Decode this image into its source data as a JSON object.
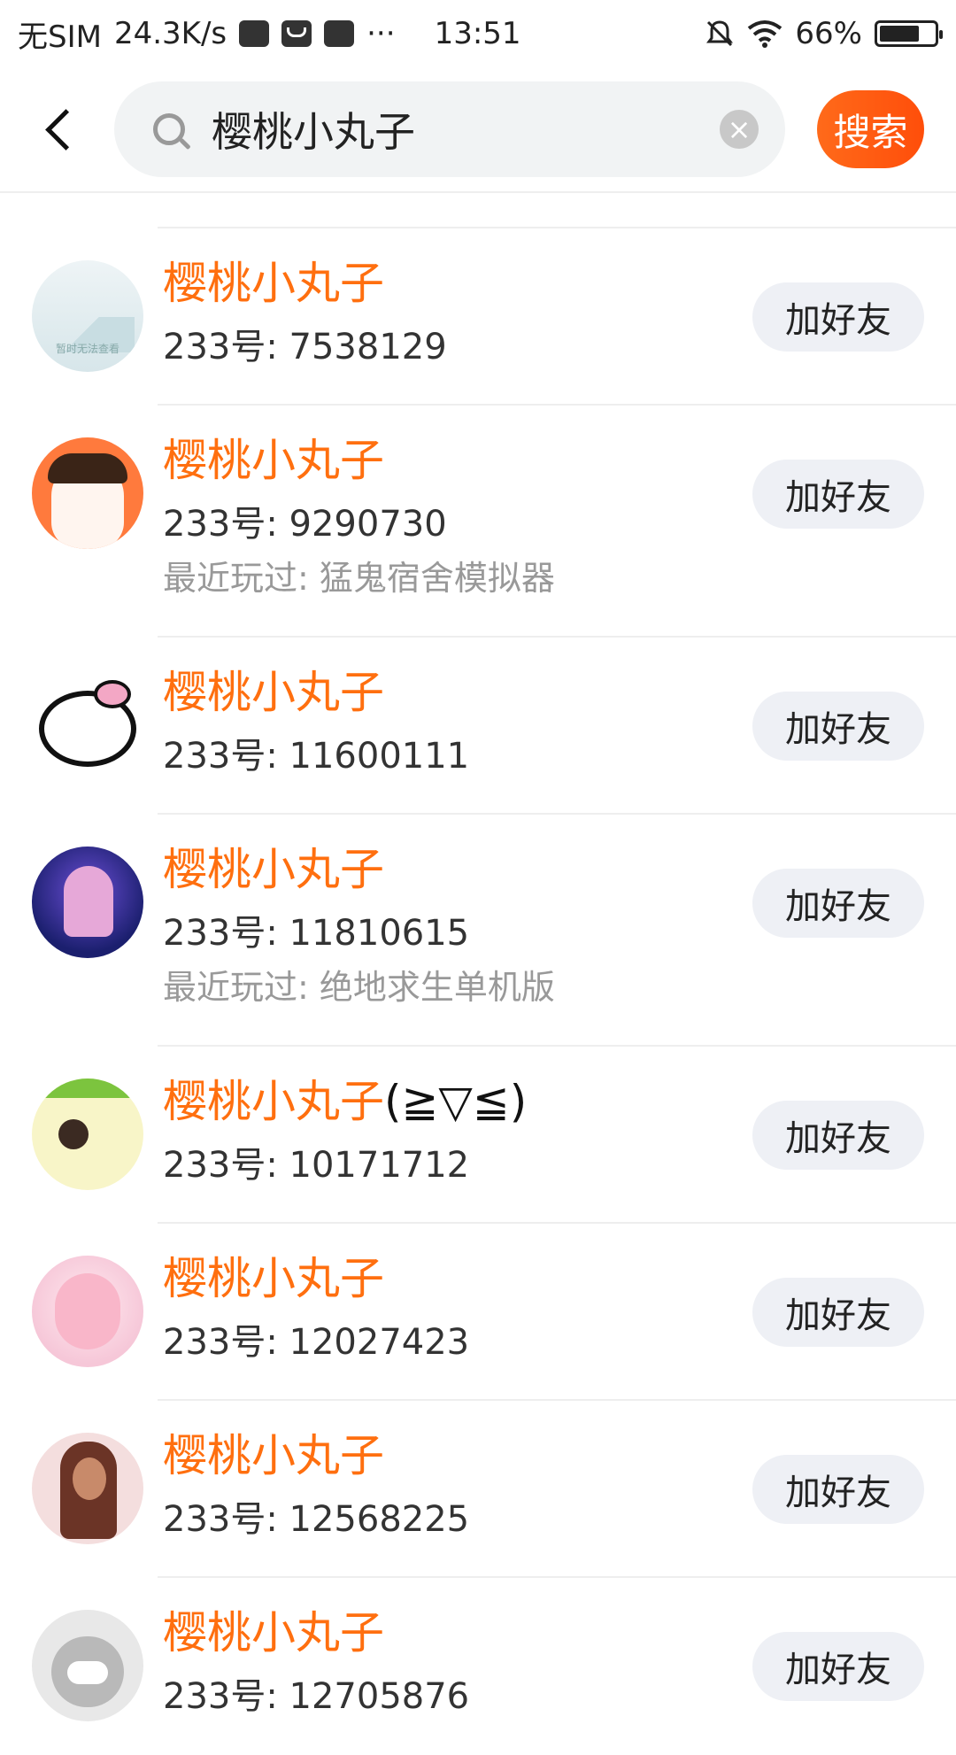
{
  "status_bar": {
    "carrier": "无SIM",
    "net_speed": "24.3K/s",
    "more": "···",
    "time": "13:51",
    "battery": "66%"
  },
  "search": {
    "query": "樱桃小丸子",
    "button_label": "搜索"
  },
  "results": [
    {
      "name": "樱桃小丸子",
      "suffix": "",
      "id_label": "233号: 7538129",
      "recent": "",
      "button": "加好友",
      "avatar_text": "暂时无法查看"
    },
    {
      "name": "樱桃小丸子",
      "suffix": "",
      "id_label": "233号: 9290730",
      "recent": "最近玩过: 猛鬼宿舍模拟器",
      "button": "加好友"
    },
    {
      "name": "樱桃小丸子",
      "suffix": "",
      "id_label": "233号: 11600111",
      "recent": "",
      "button": "加好友"
    },
    {
      "name": "樱桃小丸子",
      "suffix": "",
      "id_label": "233号: 11810615",
      "recent": "最近玩过: 绝地求生单机版",
      "button": "加好友"
    },
    {
      "name": "樱桃小丸子",
      "suffix": "(≧▽≦)",
      "id_label": "233号: 10171712",
      "recent": "",
      "button": "加好友"
    },
    {
      "name": "樱桃小丸子",
      "suffix": "",
      "id_label": "233号: 12027423",
      "recent": "",
      "button": "加好友"
    },
    {
      "name": "樱桃小丸子",
      "suffix": "",
      "id_label": "233号: 12568225",
      "recent": "",
      "button": "加好友"
    },
    {
      "name": "樱桃小丸子",
      "suffix": "",
      "id_label": "233号: 12705876",
      "recent": "",
      "button": "加好友"
    }
  ]
}
